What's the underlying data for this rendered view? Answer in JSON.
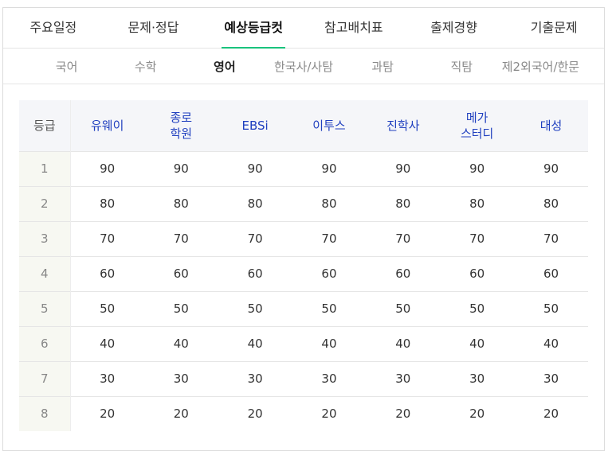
{
  "main_tabs": [
    {
      "label": "주요일정",
      "active": false
    },
    {
      "label": "문제·정답",
      "active": false
    },
    {
      "label": "예상등급컷",
      "active": true
    },
    {
      "label": "참고배치표",
      "active": false
    },
    {
      "label": "출제경향",
      "active": false
    },
    {
      "label": "기출문제",
      "active": false
    }
  ],
  "sub_tabs": [
    {
      "label": "국어",
      "active": false
    },
    {
      "label": "수학",
      "active": false
    },
    {
      "label": "영어",
      "active": true
    },
    {
      "label": "한국사/사탐",
      "active": false
    },
    {
      "label": "과탐",
      "active": false
    },
    {
      "label": "직탐",
      "active": false
    },
    {
      "label": "제2외국어/한문",
      "active": false
    }
  ],
  "table": {
    "headers": [
      "등급",
      "유웨이",
      "종로\n학원",
      "EBSi",
      "이투스",
      "진학사",
      "메가\n스터디",
      "대성"
    ],
    "rows": [
      [
        "1",
        "90",
        "90",
        "90",
        "90",
        "90",
        "90",
        "90"
      ],
      [
        "2",
        "80",
        "80",
        "80",
        "80",
        "80",
        "80",
        "80"
      ],
      [
        "3",
        "70",
        "70",
        "70",
        "70",
        "70",
        "70",
        "70"
      ],
      [
        "4",
        "60",
        "60",
        "60",
        "60",
        "60",
        "60",
        "60"
      ],
      [
        "5",
        "50",
        "50",
        "50",
        "50",
        "50",
        "50",
        "50"
      ],
      [
        "6",
        "40",
        "40",
        "40",
        "40",
        "40",
        "40",
        "40"
      ],
      [
        "7",
        "30",
        "30",
        "30",
        "30",
        "30",
        "30",
        "30"
      ],
      [
        "8",
        "20",
        "20",
        "20",
        "20",
        "20",
        "20",
        "20"
      ]
    ]
  },
  "colors": {
    "accent_underline": "#19c37d",
    "header_text": "#1f3fbf",
    "header_bg": "#f5f6f9",
    "grade_bg": "#f7f8f2"
  }
}
